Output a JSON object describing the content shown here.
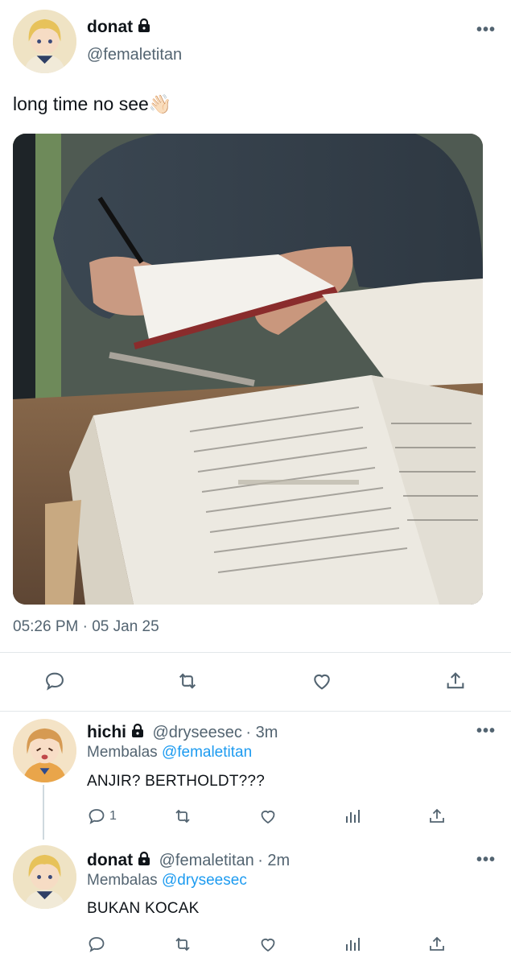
{
  "main_tweet": {
    "author_name": "donat",
    "author_handle": "@femaletitan",
    "text": "long time no see👋🏻",
    "timestamp": "05:26 PM · 05 Jan 25",
    "image_description_icon": "photo-of-person-studying-bible"
  },
  "replies": [
    {
      "author_name": "hichi",
      "author_handle": "@dryseesec",
      "time_ago": "· 3m",
      "replying_prefix": "Membalas",
      "replying_to": "@femaletitan",
      "text": "ANJIR? BERTHOLDT???",
      "reply_count": "1"
    },
    {
      "author_name": "donat",
      "author_handle": "@femaletitan",
      "time_ago": "· 2m",
      "replying_prefix": "Membalas",
      "replying_to": "@dryseesec",
      "text": "BUKAN KOCAK",
      "reply_count": ""
    }
  ],
  "colors": {
    "accent": "#1d9bf0",
    "secondary_text": "#536471",
    "primary_text": "#0f1419",
    "divider": "#e3e7ea"
  }
}
